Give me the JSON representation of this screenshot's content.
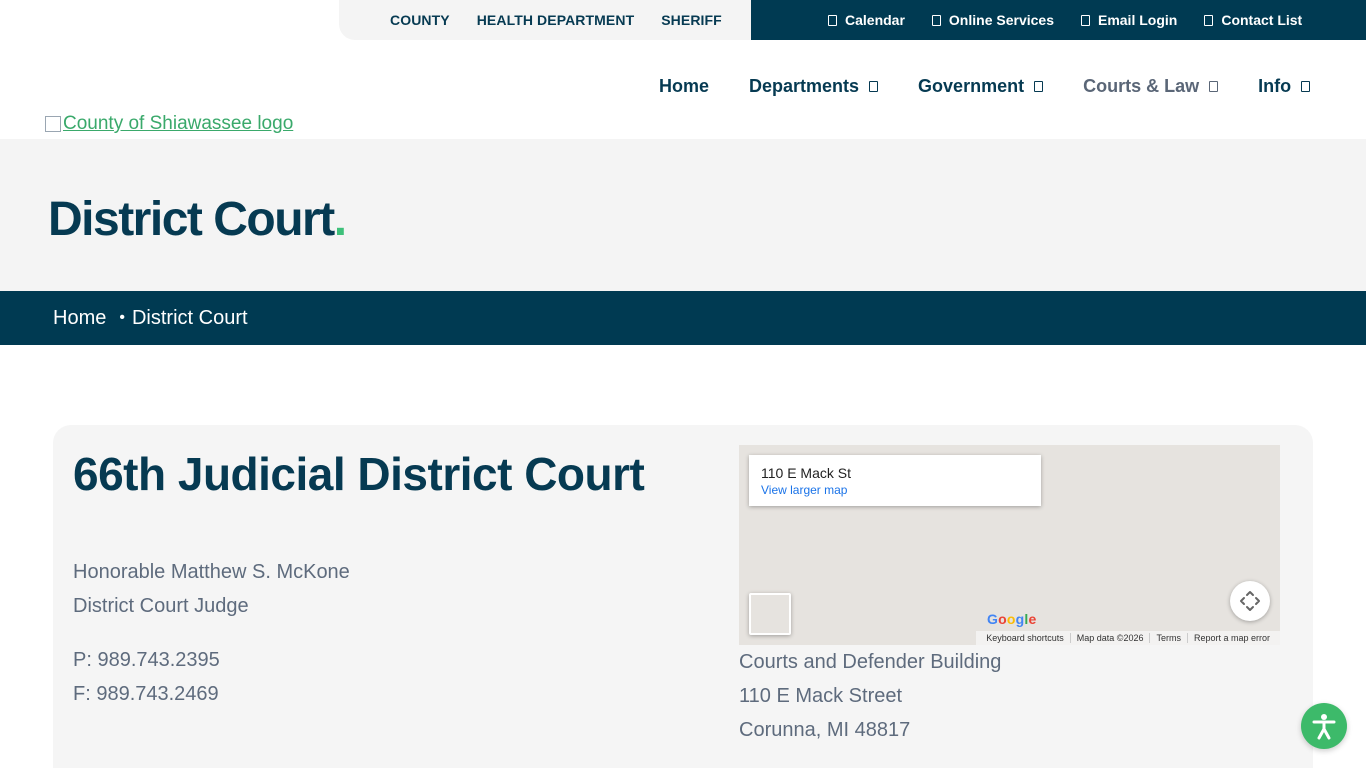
{
  "topbar": {
    "left_links": [
      "COUNTY",
      "HEALTH DEPARTMENT",
      "SHERIFF"
    ],
    "right_links": [
      "Calendar",
      "Online Services",
      "Email Login",
      "Contact List"
    ]
  },
  "header": {
    "logo_alt": "County of Shiawassee logo",
    "nav": {
      "home": "Home",
      "departments": "Departments",
      "government": "Government",
      "courts": "Courts & Law",
      "info": "Info"
    }
  },
  "hero": {
    "title": "District Court",
    "title_dot": "."
  },
  "breadcrumb": {
    "home": "Home",
    "separator": "•",
    "current": "District Court"
  },
  "court": {
    "title": "66th Judicial District Court",
    "judge_name": "Honorable Matthew S. McKone",
    "judge_role": "District Court Judge",
    "phone": "P: 989.743.2395",
    "fax": "F: 989.743.2469"
  },
  "map": {
    "address": "110 E Mack St",
    "larger_link": "View larger map",
    "footer": [
      "Keyboard shortcuts",
      "Map data ©2026",
      "Terms",
      "Report a map error"
    ]
  },
  "location": {
    "building": "Courts and Defender Building",
    "street": "110 E Mack Street",
    "city": "Corunna, MI 48817"
  },
  "colors": {
    "navy": "#003a52",
    "green": "#3ec07a",
    "text_gray": "#5e6b7d",
    "light_bg": "#f4f4f4"
  }
}
